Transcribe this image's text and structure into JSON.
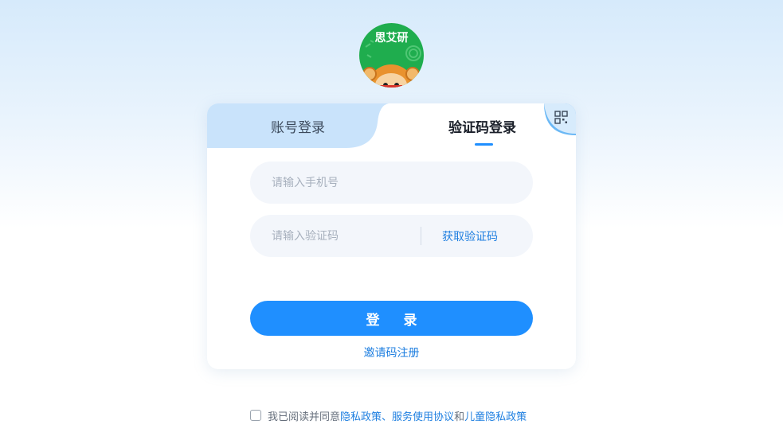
{
  "logo": {
    "text": "思艾研"
  },
  "tabs": {
    "account_label": "账号登录",
    "code_label": "验证码登录",
    "active": "code"
  },
  "form": {
    "phone_placeholder": "请输入手机号",
    "code_placeholder": "请输入验证码",
    "get_code_label": "获取验证码",
    "login_label": "登 录",
    "invite_label": "邀请码注册"
  },
  "agreement": {
    "checked": false,
    "prefix": "我已阅读并同意",
    "privacy": "隐私政策",
    "sep1": "、",
    "service": "服务使用协议",
    "sep2": "和",
    "children": "儿童隐私政策"
  },
  "colors": {
    "accent": "#1f8fff",
    "link": "#1f7fe0",
    "tab_inactive_bg": "#c9e3fb",
    "logo_bg": "#1fad4e"
  }
}
